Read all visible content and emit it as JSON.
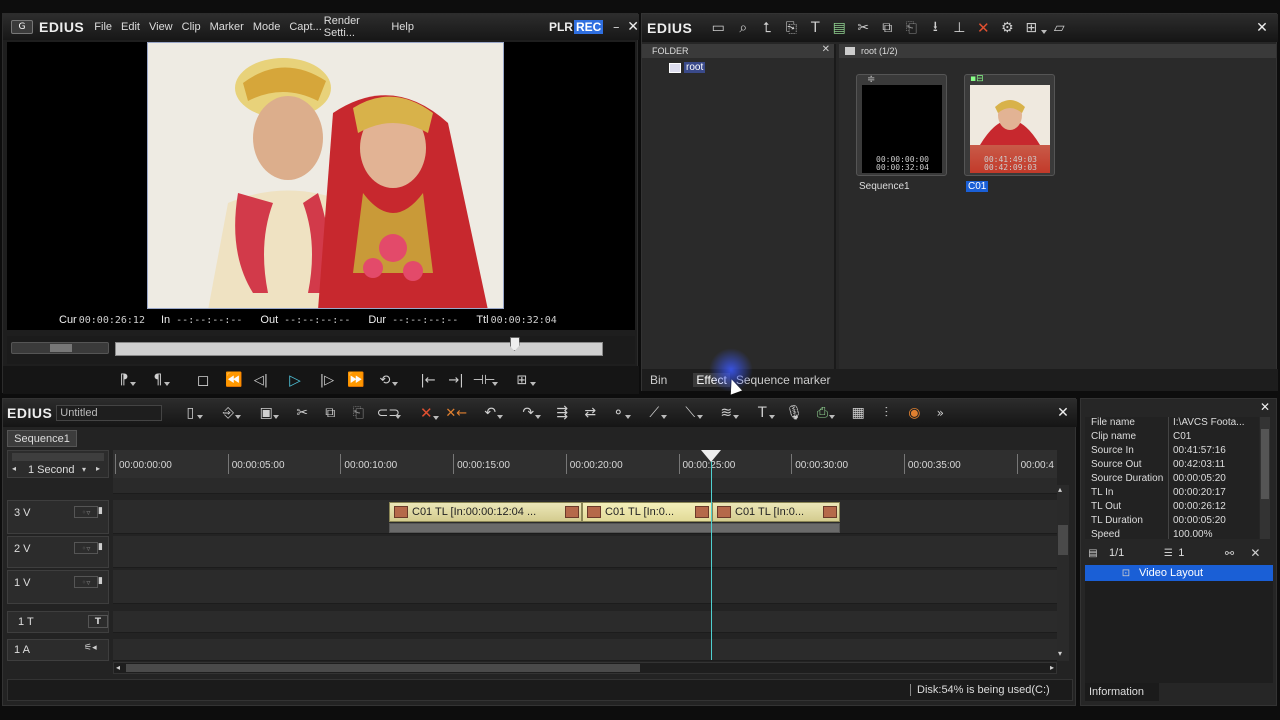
{
  "player": {
    "brand": "EDIUS",
    "menu": [
      "File",
      "Edit",
      "View",
      "Clip",
      "Marker",
      "Mode",
      "Capt...",
      "Render Setti...",
      "Help"
    ],
    "plr": "PLR",
    "rec": "REC",
    "timecodes": {
      "cur_label": "Cur",
      "cur": "00:00:26:12",
      "in_label": "In",
      "in": "--:--:--:--",
      "out_label": "Out",
      "out": "--:--:--:--",
      "dur_label": "Dur",
      "dur": "--:--:--:--",
      "ttl_label": "Ttl",
      "ttl": "00:00:32:04"
    },
    "scrub_position": 0.82
  },
  "bin": {
    "brand": "EDIUS",
    "folder_header": "FOLDER",
    "root_label": "root",
    "clips_header": "root (1/2)",
    "clips": [
      {
        "name": "Sequence1",
        "tc_in": "00:00:00:00",
        "tc_out": "00:00:32:04",
        "selected": false
      },
      {
        "name": "C01",
        "tc_in": "00:41:49:03",
        "tc_out": "00:42:09:03",
        "selected": true
      }
    ],
    "tabs": [
      "Bin",
      "Effect",
      "Sequence marker"
    ],
    "active_tab": "Effect"
  },
  "timeline": {
    "brand": "EDIUS",
    "project_name": "Untitled",
    "sequence_tab": "Sequence1",
    "scale": "1 Second",
    "ruler_ticks": [
      "00:00:00:00",
      "00:00:05:00",
      "00:00:10:00",
      "00:00:15:00",
      "00:00:20:00",
      "00:00:25:00",
      "00:00:30:00",
      "00:00:35:00",
      "00:00:4"
    ],
    "tracks": [
      "3 V",
      "2 V",
      "1 V",
      "1 T",
      "1 A"
    ],
    "clips": [
      {
        "label": "C01  TL [In:00:00:12:04 ..."
      },
      {
        "label": "C01  TL [In:0..."
      },
      {
        "label": "C01  TL [In:0..."
      }
    ],
    "status": "Disk:54% is being used(C:)"
  },
  "info": {
    "rows": [
      {
        "k": "File name",
        "v": "I:\\AVCS Foota..."
      },
      {
        "k": "Clip name",
        "v": "C01"
      },
      {
        "k": "Source In",
        "v": "00:41:57:16"
      },
      {
        "k": "Source Out",
        "v": "00:42:03:11"
      },
      {
        "k": "Source Duration",
        "v": "00:00:05:20"
      },
      {
        "k": "TL In",
        "v": "00:00:20:17"
      },
      {
        "k": "TL Out",
        "v": "00:00:26:12"
      },
      {
        "k": "TL Duration",
        "v": "00:00:05:20"
      },
      {
        "k": "Speed",
        "v": "100.00%"
      }
    ],
    "layer_count": "1/1",
    "filter_count": "1",
    "filter_item": "Video Layout",
    "tab": "Information"
  },
  "colors": {
    "accent_blue": "#1a5fd6",
    "rec_blue": "#2f6fe0",
    "playhead": "#4fd0d0",
    "clip_yellow": "#e6e0ad"
  }
}
